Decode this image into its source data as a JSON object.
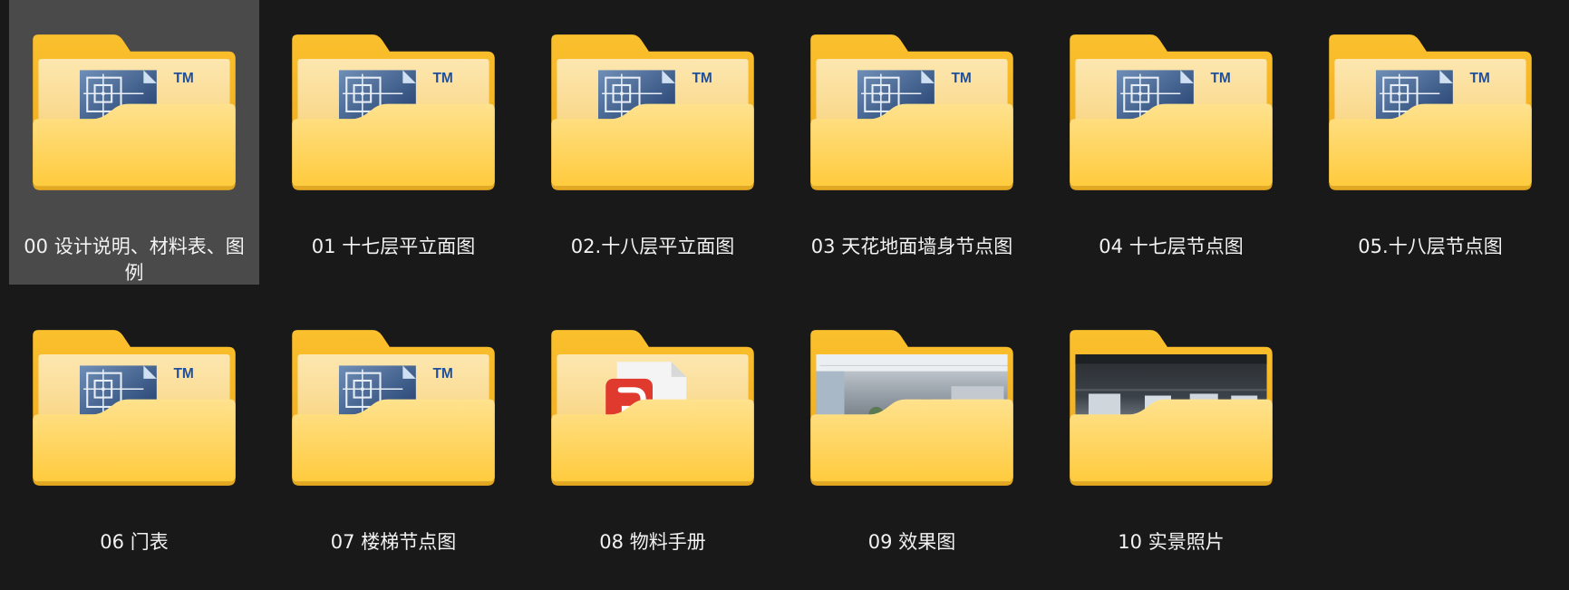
{
  "explorer": {
    "view": "large-icons",
    "selected_index": 0,
    "items": [
      {
        "name": "00  设计说明、材料表、图例",
        "icon": "folder-cad-icon"
      },
      {
        "name": "01 十七层平立面图",
        "icon": "folder-cad-icon"
      },
      {
        "name": "02.十八层平立面图",
        "icon": "folder-cad-icon"
      },
      {
        "name": "03 天花地面墙身节点图",
        "icon": "folder-cad-icon"
      },
      {
        "name": "04 十七层节点图",
        "icon": "folder-cad-icon"
      },
      {
        "name": "05.十八层节点图",
        "icon": "folder-cad-icon"
      },
      {
        "name": "06 门表",
        "icon": "folder-cad-icon"
      },
      {
        "name": "07 楼梯节点图",
        "icon": "folder-cad-icon"
      },
      {
        "name": "08 物料手册",
        "icon": "folder-pdf-icon"
      },
      {
        "name": "09 效果图",
        "icon": "folder-render-photo-icon"
      },
      {
        "name": "10 实景照片",
        "icon": "folder-site-photo-icon"
      }
    ]
  },
  "colors": {
    "background": "#191919",
    "selection": "#4a4a4a",
    "label_text": "#f2f2f2",
    "folder_back": "#f6b41a",
    "folder_front": "#ffd45e"
  }
}
